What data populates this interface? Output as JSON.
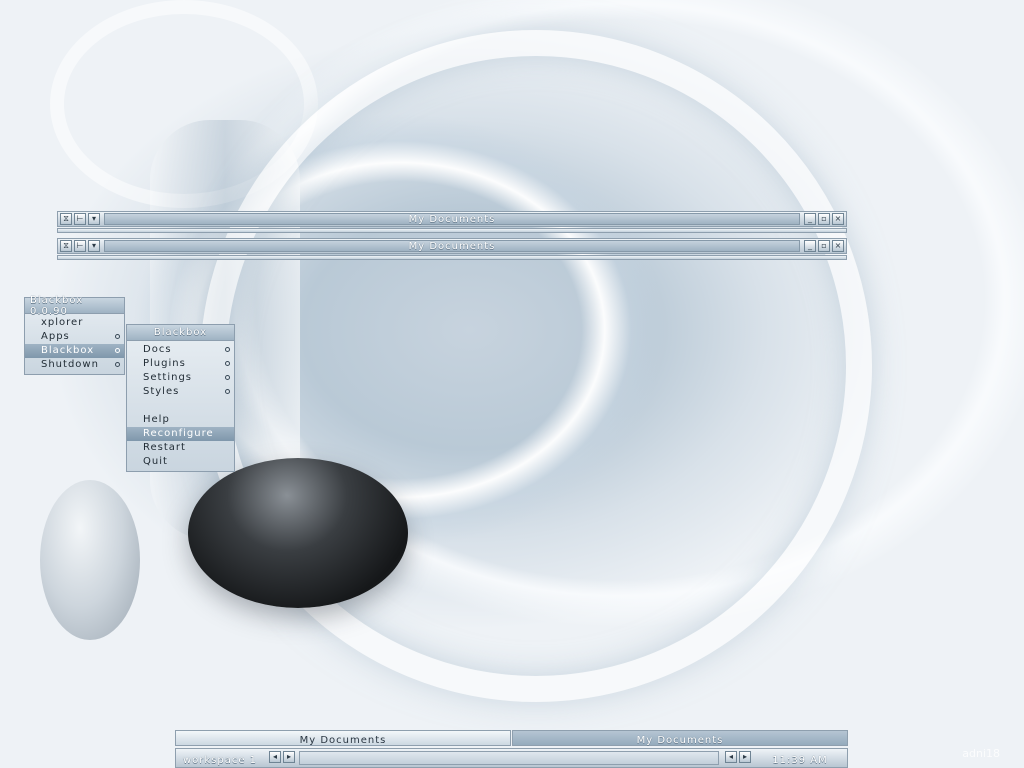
{
  "windows": [
    {
      "title": "My Documents"
    },
    {
      "title": "My Documents"
    }
  ],
  "window_buttons": {
    "left": [
      "⧖",
      "⊢",
      "▾"
    ],
    "right": [
      "_",
      "▫",
      "×"
    ]
  },
  "root_menu": {
    "title": "Blackbox 0.0.90",
    "items": [
      {
        "label": "xplorer"
      },
      {
        "label": "Apps"
      },
      {
        "label": "Blackbox"
      },
      {
        "label": "Shutdown"
      }
    ]
  },
  "blackbox_menu": {
    "title": "Blackbox",
    "items": [
      {
        "label": "Docs"
      },
      {
        "label": "Plugins"
      },
      {
        "label": "Settings"
      },
      {
        "label": "Styles"
      },
      {
        "label": "Help"
      },
      {
        "label": "Reconfigure"
      },
      {
        "label": "Restart"
      },
      {
        "label": "Quit"
      }
    ]
  },
  "taskbar": {
    "tasks": [
      {
        "label": "My Documents"
      },
      {
        "label": "My Documents"
      }
    ]
  },
  "toolbar": {
    "workspace": "workspace 1",
    "clock": "11:39 AM",
    "prev_glyph": "◂",
    "next_glyph": "▸"
  },
  "watermark": "adni18"
}
